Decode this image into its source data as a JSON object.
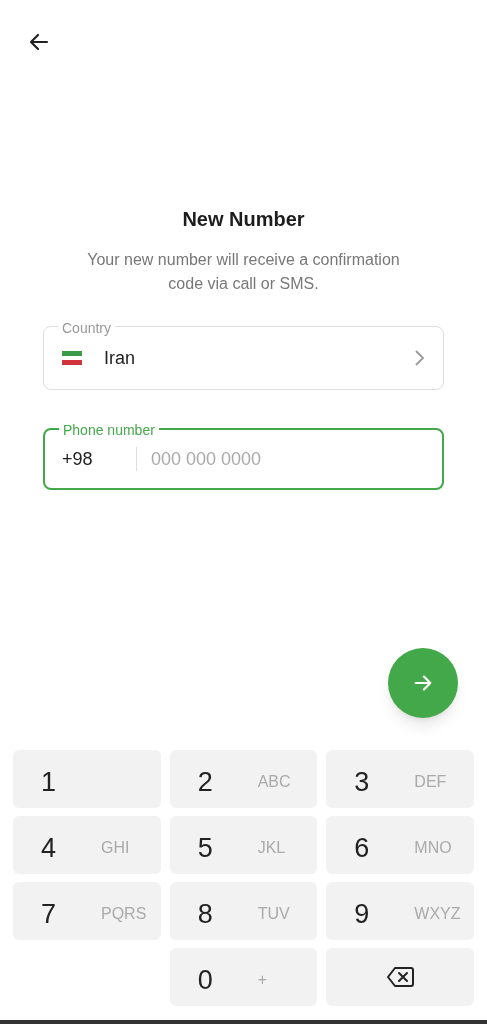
{
  "title": "New Number",
  "subtitle": "Your new number will receive a confirmation code via call or SMS.",
  "country": {
    "label": "Country",
    "value": "Iran"
  },
  "phone": {
    "label": "Phone number",
    "code": "+98",
    "placeholder": "000 000 0000",
    "focused": true
  },
  "keypad": [
    {
      "kind": "digit",
      "digit": "1"
    },
    {
      "kind": "digit",
      "digit": "2",
      "letters": "ABC"
    },
    {
      "kind": "digit",
      "digit": "3",
      "letters": "DEF"
    },
    {
      "kind": "digit",
      "digit": "4",
      "letters": "GHI"
    },
    {
      "kind": "digit",
      "digit": "5",
      "letters": "JKL"
    },
    {
      "kind": "digit",
      "digit": "6",
      "letters": "MNO"
    },
    {
      "kind": "digit",
      "digit": "7",
      "letters": "PQRS"
    },
    {
      "kind": "digit",
      "digit": "8",
      "letters": "TUV"
    },
    {
      "kind": "digit",
      "digit": "9",
      "letters": "WXYZ"
    },
    {
      "kind": "blank"
    },
    {
      "kind": "digit",
      "digit": "0",
      "letters": "+"
    },
    {
      "kind": "backspace"
    }
  ]
}
